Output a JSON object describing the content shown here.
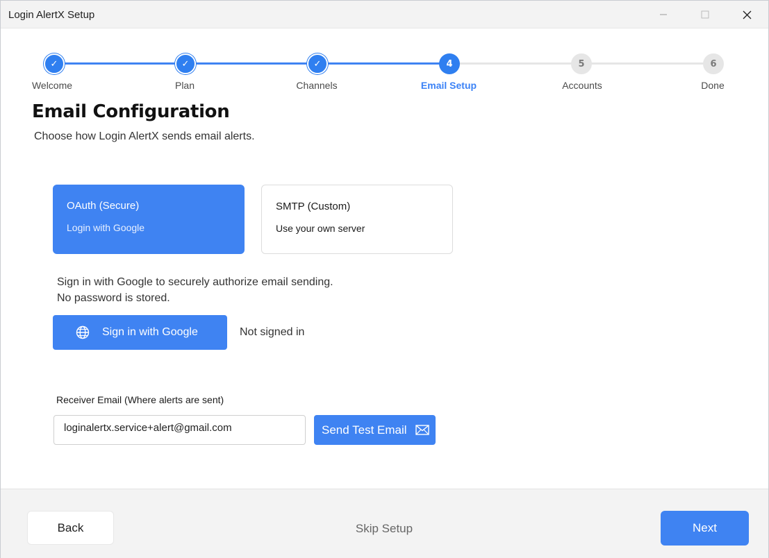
{
  "window": {
    "title": "Login AlertX Setup"
  },
  "stepper": {
    "steps": [
      {
        "number": "1",
        "label": "Welcome",
        "state": "done"
      },
      {
        "number": "2",
        "label": "Plan",
        "state": "done"
      },
      {
        "number": "3",
        "label": "Channels",
        "state": "done"
      },
      {
        "number": "4",
        "label": "Email Setup",
        "state": "active"
      },
      {
        "number": "5",
        "label": "Accounts",
        "state": "todo"
      },
      {
        "number": "6",
        "label": "Done",
        "state": "todo"
      }
    ],
    "done_mark": "✓"
  },
  "page": {
    "title": "Email Configuration",
    "subtitle": "Choose how Login AlertX sends email alerts."
  },
  "methods": {
    "oauth": {
      "title": "OAuth (Secure)",
      "subtitle": "Login with Google",
      "selected": true
    },
    "smtp": {
      "title": "SMTP (Custom)",
      "subtitle": "Use your own server",
      "selected": false
    }
  },
  "oauth_panel": {
    "info_line1": "Sign in with Google to securely authorize email sending.",
    "info_line2": "No password is stored.",
    "sign_in_label": "Sign in with Google",
    "sign_in_icon": "globe-icon",
    "status": "Not signed in"
  },
  "receiver": {
    "label": "Receiver Email (Where alerts are sent)",
    "value": "loginalertx.service+alert@gmail.com",
    "test_button_label": "Send Test Email",
    "test_button_icon": "mail-icon"
  },
  "footer": {
    "back_label": "Back",
    "skip_label": "Skip Setup",
    "next_label": "Next"
  },
  "colors": {
    "accent": "#3f83f2",
    "active_step_text": "#3b82f6",
    "pending_step": "#e6e6e6"
  }
}
